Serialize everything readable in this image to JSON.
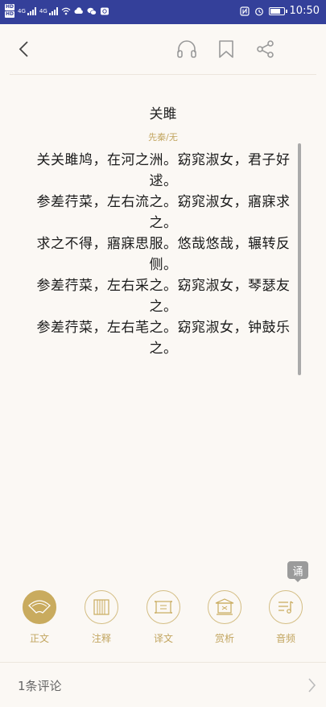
{
  "status_bar": {
    "net1": "4G",
    "net2": "4G",
    "time": "10:50",
    "hd_badge": "HD",
    "battery_level": 0.7
  },
  "toolbar": {
    "back_icon": "chevron-left-icon",
    "audio_icon": "headphones-icon",
    "bookmark_icon": "bookmark-icon",
    "share_icon": "share-icon"
  },
  "poem": {
    "title": "关雎",
    "author": "先秦/无",
    "lines": [
      "关关雎鸠，在河之洲。窈窕淑女，君子好",
      "逑。",
      "参差荇菜，左右流之。窈窕淑女，寤寐求",
      "之。",
      "求之不得，寤寐思服。悠哉悠哉，辗转反",
      "侧。",
      "参差荇菜，左右采之。窈窕淑女，琴瑟友",
      "之。",
      "参差荇菜，左右芼之。窈窕淑女，钟鼓乐",
      "之。"
    ]
  },
  "recite_label": "诵",
  "tabs": [
    {
      "label": "正文",
      "icon": "fan-icon",
      "active": true
    },
    {
      "label": "注释",
      "icon": "bamboo-scroll-icon",
      "active": false
    },
    {
      "label": "译文",
      "icon": "scroll-icon",
      "active": false
    },
    {
      "label": "赏析",
      "icon": "pavilion-icon",
      "active": false
    },
    {
      "label": "音频",
      "icon": "audio-list-icon",
      "active": false
    }
  ],
  "comments": {
    "label": "1条评论"
  },
  "colors": {
    "status_bar": "#34409a",
    "accent": "#c9ab5e",
    "background": "#fbf8f4"
  }
}
